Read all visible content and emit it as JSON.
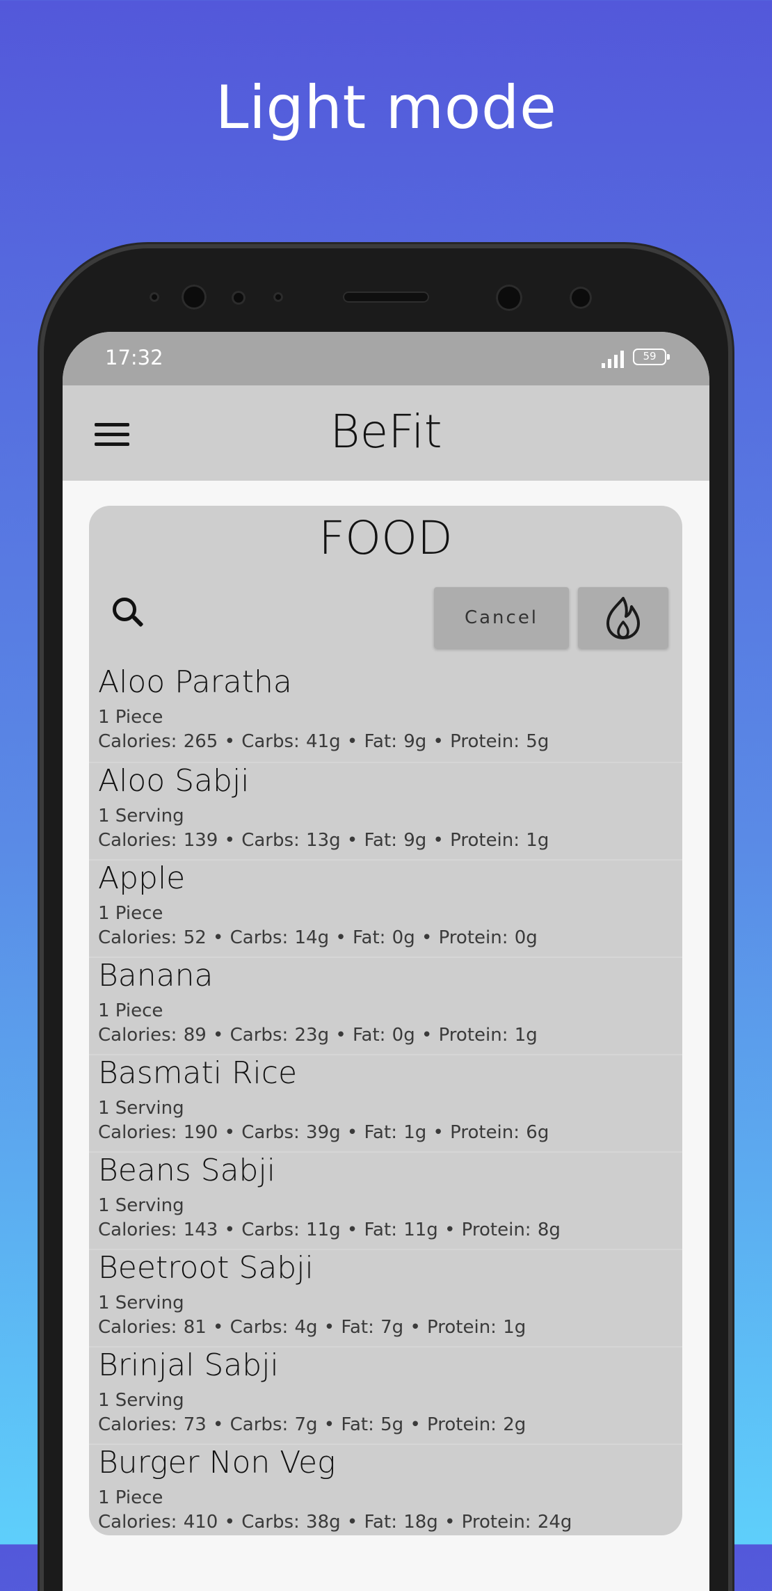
{
  "headline": "Light mode",
  "status_bar": {
    "time": "17:32",
    "battery": "59",
    "icons": [
      "signal-icon",
      "battery-icon"
    ]
  },
  "app_bar": {
    "title": "BeFit",
    "menu_icon": "hamburger-menu-icon"
  },
  "food_card": {
    "title": "FOOD",
    "search_icon": "search-icon",
    "cancel_label": "Cancel",
    "calorie_icon": "flame-icon",
    "items": [
      {
        "name": "Aloo Paratha",
        "serving": "1 Piece",
        "nutrition": "Calories: 265  •  Carbs: 41g  •  Fat: 9g  •  Protein: 5g"
      },
      {
        "name": "Aloo Sabji",
        "serving": "1 Serving",
        "nutrition": "Calories: 139  •  Carbs: 13g  •  Fat: 9g  •  Protein: 1g"
      },
      {
        "name": "Apple",
        "serving": "1 Piece",
        "nutrition": "Calories: 52  •  Carbs: 14g  •  Fat: 0g  •  Protein: 0g"
      },
      {
        "name": "Banana",
        "serving": "1 Piece",
        "nutrition": "Calories: 89  •  Carbs: 23g  •  Fat: 0g  •  Protein: 1g"
      },
      {
        "name": "Basmati Rice",
        "serving": "1 Serving",
        "nutrition": "Calories: 190  •  Carbs: 39g  •  Fat: 1g  •  Protein: 6g"
      },
      {
        "name": "Beans Sabji",
        "serving": "1 Serving",
        "nutrition": "Calories: 143  •  Carbs: 11g  •  Fat: 11g  •  Protein: 8g"
      },
      {
        "name": "Beetroot Sabji",
        "serving": "1 Serving",
        "nutrition": "Calories: 81  •  Carbs: 4g  •  Fat: 7g  •  Protein: 1g"
      },
      {
        "name": "Brinjal Sabji",
        "serving": "1 Serving",
        "nutrition": "Calories: 73  •  Carbs: 7g  •  Fat: 5g  •  Protein: 2g"
      },
      {
        "name": "Burger Non Veg",
        "serving": "1 Piece",
        "nutrition": "Calories: 410  •  Carbs: 38g  •  Fat: 18g  •  Protein: 24g"
      }
    ]
  }
}
